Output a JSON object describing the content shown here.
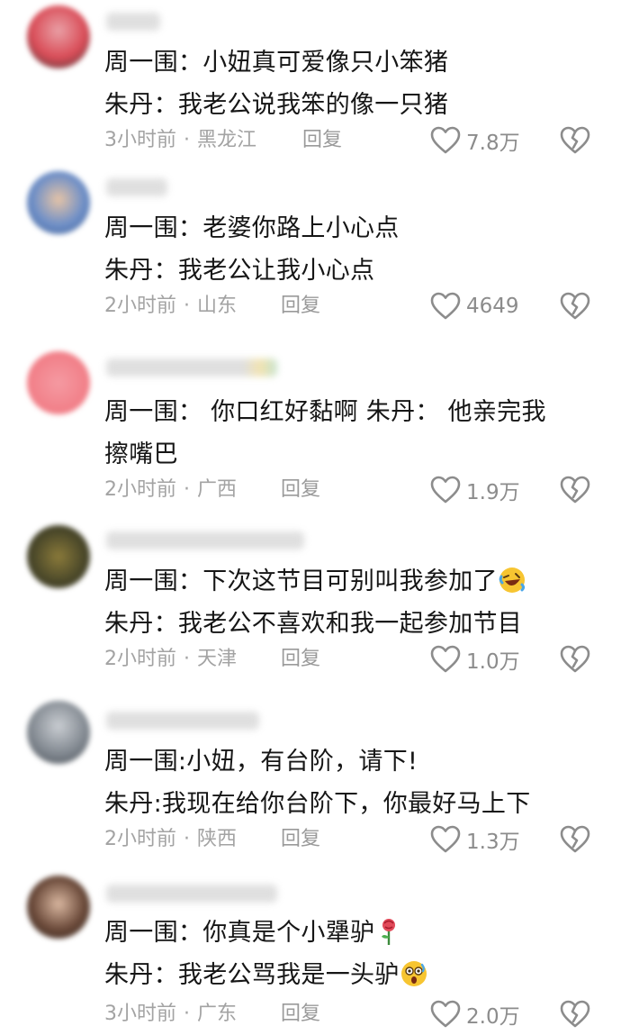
{
  "comments": [
    {
      "lines": [
        "周一围：小妞真可爱像只小笨猪",
        "朱丹：我老公说我笨的像一只猪"
      ],
      "meta": {
        "time": "3小时前",
        "location": "黑龙江",
        "reply": "回复"
      },
      "likes": "7.8万",
      "avatar_color": "#d94c57"
    },
    {
      "lines": [
        "周一围：老婆你路上小心点",
        "朱丹：我老公让我小心点"
      ],
      "meta": {
        "time": "2小时前",
        "location": "山东",
        "reply": "回复"
      },
      "likes": "4649",
      "avatar_color": "#5f7fb8"
    },
    {
      "lines": [
        "周一围： 你口红好黏啊  朱丹： 他亲完我",
        "擦嘴巴"
      ],
      "meta": {
        "time": "2小时前",
        "location": "广西",
        "reply": "回复"
      },
      "likes": "1.9万",
      "avatar_color": "#f17d86"
    },
    {
      "lines": [
        "周一围：下次这节目可别叫我参加了",
        "朱丹：我老公不喜欢和我一起参加节目"
      ],
      "meta": {
        "time": "2小时前",
        "location": "天津",
        "reply": "回复"
      },
      "likes": "1.0万",
      "avatar_color": "#4d4a2a"
    },
    {
      "lines": [
        "周一围:小妞，有台阶，请下!",
        "朱丹:我现在给你台阶下，你最好马上下"
      ],
      "meta": {
        "time": "2小时前",
        "location": "陕西",
        "reply": "回复"
      },
      "likes": "1.3万",
      "avatar_color": "#7d848c"
    },
    {
      "lines": [
        "周一围：你真是个小犟驴",
        "朱丹：我老公骂我是一头驴"
      ],
      "meta": {
        "time": "3小时前",
        "location": "广东",
        "reply": "回复"
      },
      "likes": "2.0万",
      "avatar_color": "#6b4a3a"
    }
  ]
}
